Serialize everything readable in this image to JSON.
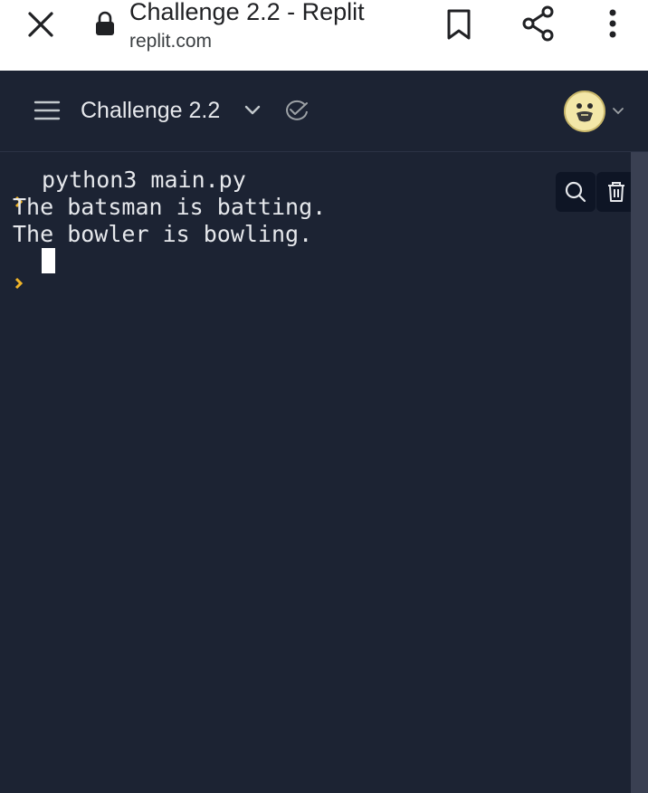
{
  "browser": {
    "tab_title": "Challenge 2.2 - Replit",
    "url": "replit.com",
    "icons": [
      "close-icon",
      "lock-icon",
      "bookmark-icon",
      "share-icon",
      "more-vert-icon"
    ]
  },
  "header": {
    "project_name": "Challenge 2.2",
    "icons": [
      "hamburger-menu-icon",
      "chevron-down-icon",
      "checkmark-badge-icon",
      "avatar",
      "chevron-down-icon"
    ]
  },
  "console": {
    "command": "python3 main.py",
    "output": [
      "The batsman is batting.",
      "The bowler is bowling."
    ],
    "icons": [
      "search-icon",
      "trash-icon"
    ],
    "colors": {
      "background": "#1c2333",
      "prompt": "#f0b429",
      "text": "#e6e8ec"
    }
  }
}
